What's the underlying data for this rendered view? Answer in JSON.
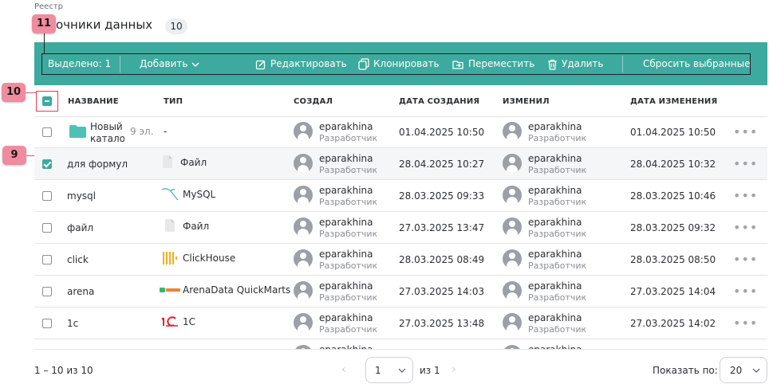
{
  "breadcrumb": "Реестр",
  "title": "очники данных",
  "total_badge": "10",
  "toolbar": {
    "selected": "Выделено: 1",
    "add": "Добавить",
    "edit": "Редактировать",
    "clone": "Клонировать",
    "move": "Переместить",
    "delete": "Удалить",
    "reset": "Сбросить выбранные"
  },
  "callouts": {
    "c9": "9",
    "c10": "10",
    "c11": "11"
  },
  "columns": {
    "name": "НАЗВАНИЕ",
    "type": "ТИП",
    "created_by": "СОЗДАЛ",
    "created_at": "ДАТА СОЗДАНИЯ",
    "modified_by": "ИЗМЕНИЛ",
    "modified_at": "ДАТА ИЗМЕНЕНИЯ"
  },
  "rows": [
    {
      "name_line1": "Новый",
      "name_line2": "каталог",
      "items": "9 эл.",
      "type": "-",
      "type_icon": "none",
      "creator": "eparakhina",
      "creator_role": "Разработчик",
      "created": "01.04.2025 10:50",
      "modifier": "eparakhina",
      "modifier_role": "Разработчик",
      "modified": "01.04.2025 10:50",
      "checked": false
    },
    {
      "name": "для формул",
      "type": "Файл",
      "type_icon": "file-icon",
      "creator": "eparakhina",
      "creator_role": "Разработчик",
      "created": "28.04.2025 10:27",
      "modifier": "eparakhina",
      "modifier_role": "Разработчик",
      "modified": "28.04.2025 10:32",
      "checked": true
    },
    {
      "name": "mysql",
      "type": "MySQL",
      "type_icon": "mysql-icon",
      "creator": "eparakhina",
      "creator_role": "Разработчик",
      "created": "28.03.2025 09:33",
      "modifier": "eparakhina",
      "modifier_role": "Разработчик",
      "modified": "28.03.2025 10:46",
      "checked": false
    },
    {
      "name": "файл",
      "type": "Файл",
      "type_icon": "file-icon",
      "creator": "eparakhina",
      "creator_role": "Разработчик",
      "created": "27.03.2025 13:47",
      "modifier": "eparakhina",
      "modifier_role": "Разработчик",
      "modified": "28.03.2025 09:32",
      "checked": false
    },
    {
      "name": "click",
      "type": "ClickHouse",
      "type_icon": "clickhouse-icon",
      "creator": "eparakhina",
      "creator_role": "Разработчик",
      "created": "28.03.2025 08:49",
      "modifier": "eparakhina",
      "modifier_role": "Разработчик",
      "modified": "28.03.2025 08:50",
      "checked": false
    },
    {
      "name": "arena",
      "type": "ArenaData QuickMarts",
      "type_icon": "arenadata-icon",
      "creator": "eparakhina",
      "creator_role": "Разработчик",
      "created": "27.03.2025 14:03",
      "modifier": "eparakhina",
      "modifier_role": "Разработчик",
      "modified": "27.03.2025 14:04",
      "checked": false
    },
    {
      "name": "1c",
      "type": "1С",
      "type_icon": "1c-icon",
      "creator": "eparakhina",
      "creator_role": "Разработчик",
      "created": "27.03.2025 13:48",
      "modifier": "eparakhina",
      "modifier_role": "Разработчик",
      "modified": "27.03.2025 14:02",
      "checked": false
    },
    {
      "creator": "eparakhina",
      "modifier": "eparakhina",
      "partial": true
    }
  ],
  "footer": {
    "range": "1 – 10 из 10",
    "page": "1",
    "of": "из 1",
    "show_label": "Показать по:",
    "page_size": "20"
  },
  "colors": {
    "accent": "#3daa9f",
    "callout": "#f08ca0"
  }
}
